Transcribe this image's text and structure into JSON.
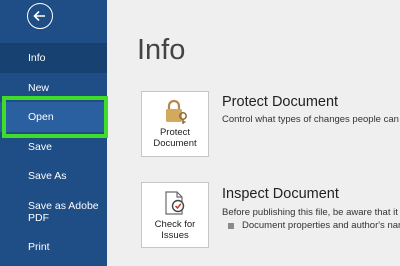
{
  "sidebar": {
    "items": [
      {
        "label": "Info"
      },
      {
        "label": "New"
      },
      {
        "label": "Open"
      },
      {
        "label": "Save"
      },
      {
        "label": "Save As"
      },
      {
        "label": "Save as Adobe PDF"
      },
      {
        "label": "Print"
      }
    ]
  },
  "main": {
    "title": "Info",
    "protect": {
      "button_label": "Protect Document",
      "title": "Protect Document",
      "description": "Control what types of changes people can m"
    },
    "inspect": {
      "button_label": "Check for Issues",
      "title": "Inspect Document",
      "description": "Before publishing this file, be aware that it co",
      "bullet": "Document properties and author's nam"
    }
  },
  "colors": {
    "sidebar": "#1f4d86",
    "selected": "#2a5fa0",
    "highlight": "#3fdc29",
    "background": "#efefef"
  },
  "icons": [
    "back-arrow-icon",
    "lock-key-icon",
    "document-check-icon",
    "bullet-icon"
  ]
}
